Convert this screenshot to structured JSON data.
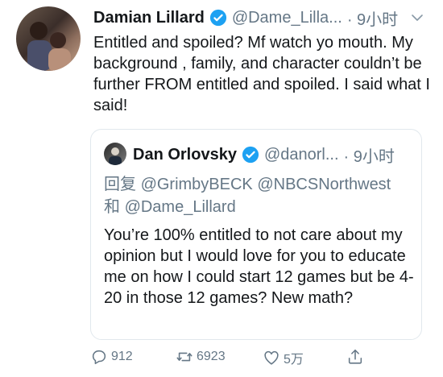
{
  "author": {
    "name": "Damian Lillard",
    "handle": "@Dame_Lilla...",
    "time": "· 9小时"
  },
  "tweet_text": "Entitled and spoiled? Mf watch yo mouth. My background , family, and character couldn’t be further FROM entitled and spoiled. I said what I said!",
  "quoted": {
    "name": "Dan Orlovsky",
    "handle": "@danorl...",
    "time": "· 9小时",
    "reply_prefix": "回复",
    "mention1": "@GrimbyBECK",
    "mention2": "@NBCSNorthwest",
    "and_word": "和",
    "mention3": "@Dame_Lillard",
    "text": "You’re 100% entitled to not care about my opinion but I would love for you to educate me on how I could start 12 games but be 4-20 in those 12 games? New math?"
  },
  "actions": {
    "reply_count": "912",
    "retweet_count": "6923",
    "like_count": "5万"
  },
  "colors": {
    "verified": "#1da1f2",
    "muted": "#657786",
    "text": "#14171a",
    "border": "#e1e8ed"
  },
  "icons": [
    "verified-icon",
    "chevron-down-icon",
    "reply-icon",
    "retweet-icon",
    "like-icon",
    "share-icon"
  ]
}
